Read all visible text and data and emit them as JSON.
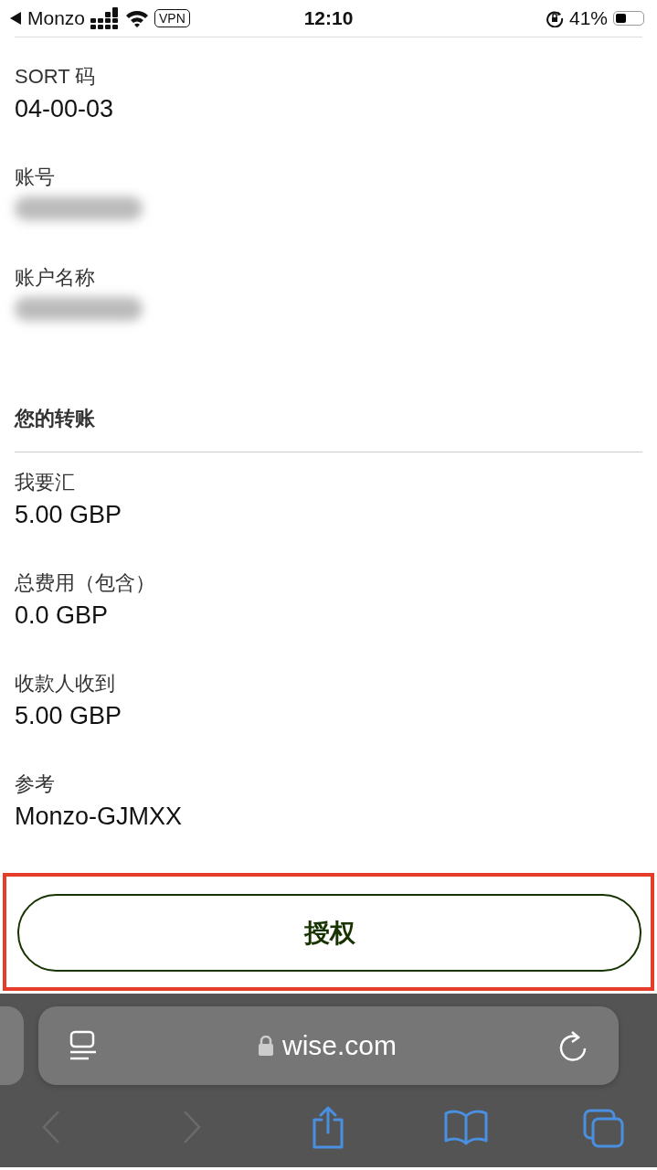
{
  "status_bar": {
    "back_app": "Monzo",
    "vpn": "VPN",
    "time": "12:10",
    "battery": "41%"
  },
  "recipient_fields": [
    {
      "label": "SORT 码",
      "value": "04-00-03",
      "kind": "text"
    },
    {
      "label": "账号",
      "kind": "redacted"
    },
    {
      "label": "账户名称",
      "kind": "redacted"
    }
  ],
  "transfer_section": {
    "title": "您的转账"
  },
  "transfer_fields": [
    {
      "label": "我要汇",
      "value": "5.00 GBP",
      "kind": "text"
    },
    {
      "label": "总费用（包含）",
      "value": "0.0 GBP",
      "kind": "text"
    },
    {
      "label": "收款人收到",
      "value": "5.00 GBP",
      "kind": "text"
    },
    {
      "label": "参考",
      "value": "Monzo-GJMXX",
      "kind": "text"
    }
  ],
  "action_button": {
    "label": "授权",
    "highlighted": true
  },
  "browser": {
    "url": "wise.com",
    "back_disabled": true,
    "forward_disabled": true
  }
}
